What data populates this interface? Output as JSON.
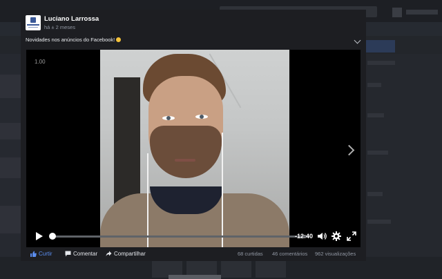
{
  "post": {
    "author": "Luciano Larrossa",
    "timestamp": "há ± 2 meses",
    "caption": "Novidades nos anúncios do Facebook!",
    "caption_emoji": "smile-emoji-icon"
  },
  "video": {
    "speed_label": "1.00",
    "time_remaining": "-12:40",
    "progress_fraction": 0.003,
    "icons": {
      "play": "play-icon",
      "volume": "volume-icon",
      "settings": "gear-icon",
      "fullscreen": "fullscreen-icon",
      "next": "chevron-right-icon"
    }
  },
  "actions": {
    "like_label": "Curtir",
    "comment_label": "Comentar",
    "share_label": "Compartilhar"
  },
  "stats": {
    "reactions": "68 curtidas",
    "comments": "46 comentários",
    "views": "962 visualizações"
  },
  "colors": {
    "like_blue": "#5b8def",
    "theater_bg": "#1d1e22",
    "overlay_bg": "#23262b"
  }
}
